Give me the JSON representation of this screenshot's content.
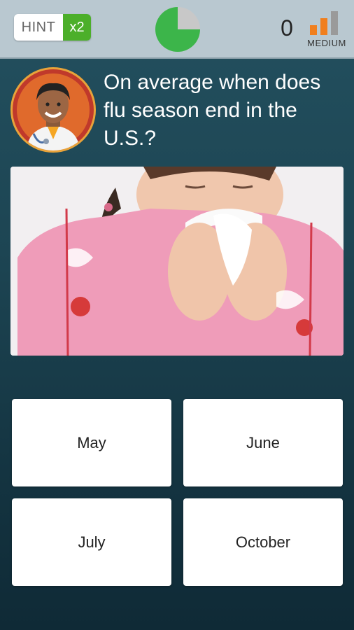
{
  "hint": {
    "label": "HINT",
    "count": "x2"
  },
  "timer": {
    "remaining_fraction": 0.75,
    "color_remaining": "#3cb54a",
    "color_elapsed": "#c8c8c8"
  },
  "score": "0",
  "difficulty": {
    "label": "MEDIUM",
    "level": 2,
    "max_level": 3,
    "active_color": "#f07f1e",
    "inactive_color": "#9a9a9a"
  },
  "avatar": {
    "icon": "doctor-avatar-icon"
  },
  "question": {
    "text": "On average when does flu season end in the U.S.?"
  },
  "photo": {
    "icon": "woman-blowing-nose-photo"
  },
  "answers": [
    {
      "label": "May"
    },
    {
      "label": "June"
    },
    {
      "label": "July"
    },
    {
      "label": "October"
    }
  ]
}
